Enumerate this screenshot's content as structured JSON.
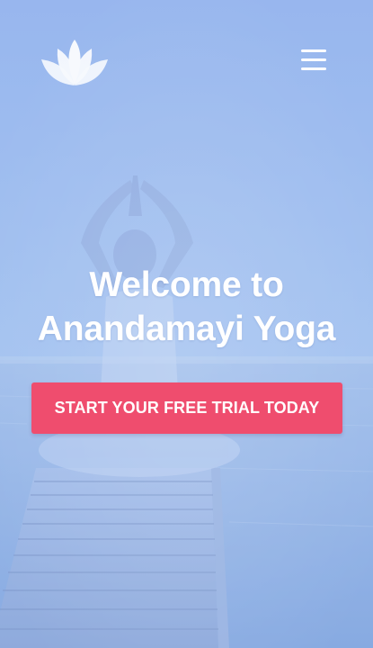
{
  "header": {
    "logo_icon": "lotus-icon",
    "menu_icon": "hamburger-menu-icon"
  },
  "hero": {
    "title_line1": "Welcome to",
    "title_line2": "Anandamayi Yoga",
    "cta_label": "START YOUR FREE TRIAL TODAY"
  },
  "colors": {
    "overlay": "#a2c0f0",
    "cta_background": "#ef4d6e",
    "text": "#ffffff"
  }
}
